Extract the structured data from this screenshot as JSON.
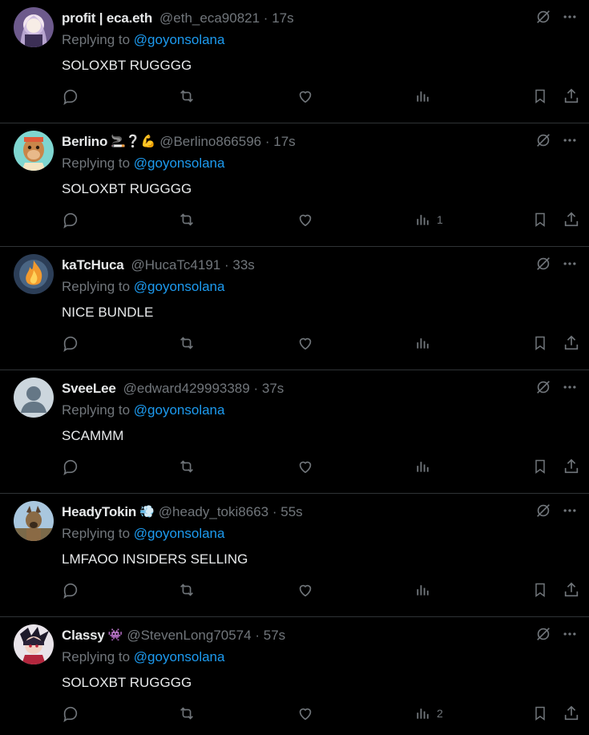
{
  "replies": [
    {
      "name": "profit | eca.eth",
      "badge": "",
      "handle": "@eth_eca90821",
      "dot": "·",
      "time": "17s",
      "replying_prefix": "Replying to",
      "replying_to": "@goyonsolana",
      "text": "SOLOXBT RUGGGG",
      "views": "",
      "avatar_icon": "avatar-anime-icon"
    },
    {
      "name": "Berlino",
      "badge": "🚬❔💪",
      "handle": "@Berlino866596",
      "dot": "·",
      "time": "17s",
      "replying_prefix": "Replying to",
      "replying_to": "@goyonsolana",
      "text": "SOLOXBT RUGGGG",
      "views": "1",
      "avatar_icon": "avatar-ape-icon"
    },
    {
      "name": "kaTcHuca",
      "badge": "",
      "handle": "@HucaTc4191",
      "dot": "·",
      "time": "33s",
      "replying_prefix": "Replying to",
      "replying_to": "@goyonsolana",
      "text": "NICE BUNDLE",
      "views": "",
      "avatar_icon": "avatar-fire-icon"
    },
    {
      "name": "SveeLee",
      "badge": "",
      "handle": "@edward429993389",
      "dot": "·",
      "time": "37s",
      "replying_prefix": "Replying to",
      "replying_to": "@goyonsolana",
      "text": "SCAMMM",
      "views": "",
      "avatar_icon": "avatar-default-icon"
    },
    {
      "name": "HeadyTokin",
      "badge": "💨",
      "handle": "@heady_toki8663",
      "dot": "·",
      "time": "55s",
      "replying_prefix": "Replying to",
      "replying_to": "@goyonsolana",
      "text": "LMFAOO INSIDERS SELLING",
      "views": "",
      "avatar_icon": "avatar-dog-icon"
    },
    {
      "name": "Classy",
      "badge": "👾",
      "handle": "@StevenLong70574",
      "dot": "·",
      "time": "57s",
      "replying_prefix": "Replying to",
      "replying_to": "@goyonsolana",
      "text": "SOLOXBT RUGGGG",
      "views": "2",
      "avatar_icon": "avatar-character-icon"
    }
  ],
  "icons": {
    "grok": "grok-icon",
    "more": "more-icon",
    "reply": "reply-icon",
    "retweet": "retweet-icon",
    "like": "like-icon",
    "views": "views-icon",
    "bookmark": "bookmark-icon",
    "share": "share-icon"
  },
  "colors": {
    "background": "#000000",
    "text": "#e7e9ea",
    "muted": "#71767b",
    "link": "#1d9bf0",
    "divider": "#2f3336"
  }
}
